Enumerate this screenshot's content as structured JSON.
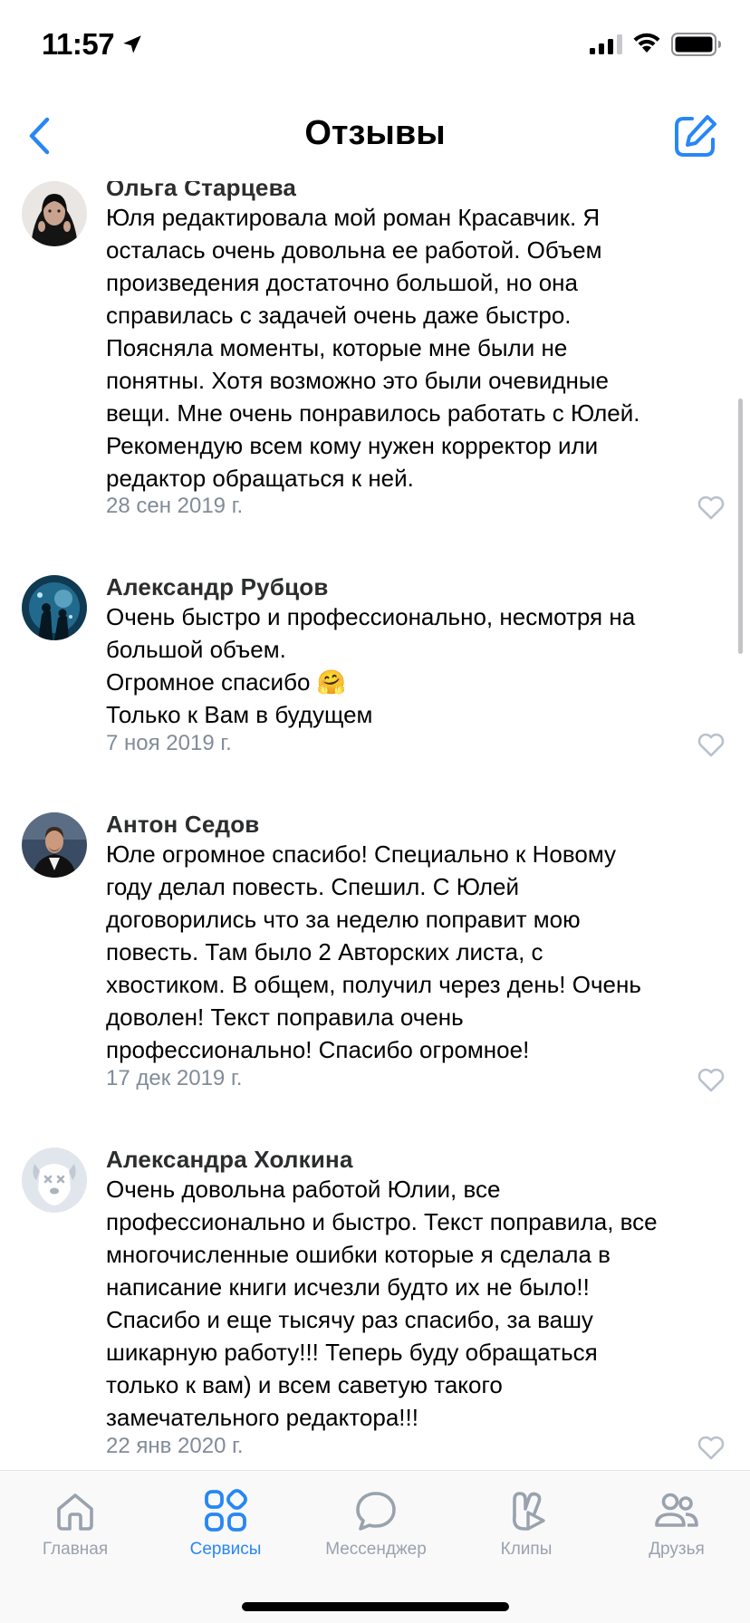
{
  "status": {
    "time": "11:57"
  },
  "nav": {
    "title": "Отзывы"
  },
  "colors": {
    "accent": "#2787f5",
    "date": "#818c99",
    "tab_inactive": "#99a2ad"
  },
  "reviews": [
    {
      "author": "Ольга Старцева",
      "text": "Юля редактировала мой роман Красавчик. Я\nосталась очень довольна ее работой. Объем\nпроизведения достаточно большой, но она\nсправилась с задачей очень даже быстро.\nПоясняла моменты, которые мне были не\nпонятны. Хотя возможно это были очевидные\nвещи. Мне очень понравилось работать с Юлей.\nРекомендую всем кому нужен корректор или\nредактор обращаться к ней.",
      "date": "28 сен 2019 г."
    },
    {
      "author": "Александр Рубцов",
      "text": "Очень быстро и профессионально, несмотря на\nбольшой объем.\nОгромное спасибо 🤗\nТолько к Вам в будущем",
      "date": "7 ноя 2019 г."
    },
    {
      "author": "Антон Седов",
      "text": "Юле огромное спасибо! Специально к Новому\nгоду делал повесть. Спешил. С Юлей\nдоговорились что за неделю поправит мою\nповесть. Там было 2 Авторских листа, с\nхвостиком. В общем, получил через день! Очень\nдоволен! Текст поправила очень\nпрофессионально! Спасибо огромное!",
      "date": "17 дек 2019 г."
    },
    {
      "author": "Александра Холкина",
      "text": "Очень довольна работой Юлии, все\nпрофессионально и быстро. Текст поправила, все\nмногочисленные ошибки которые я сделала в\nнаписание книги исчезли будто их не было!!\nСпасибо и еще тысячу раз спасибо, за вашу\nшикарную работу!!! Теперь буду обращаться\nтолько к вам) и всем саветую такого\nзамечательного редактора!!!",
      "date": "22 янв 2020 г."
    }
  ],
  "tabs": [
    {
      "label": "Главная",
      "icon": "home-icon",
      "active": false
    },
    {
      "label": "Сервисы",
      "icon": "services-icon",
      "active": true
    },
    {
      "label": "Мессенджер",
      "icon": "messenger-icon",
      "active": false
    },
    {
      "label": "Клипы",
      "icon": "clips-icon",
      "active": false
    },
    {
      "label": "Друзья",
      "icon": "friends-icon",
      "active": false
    }
  ]
}
